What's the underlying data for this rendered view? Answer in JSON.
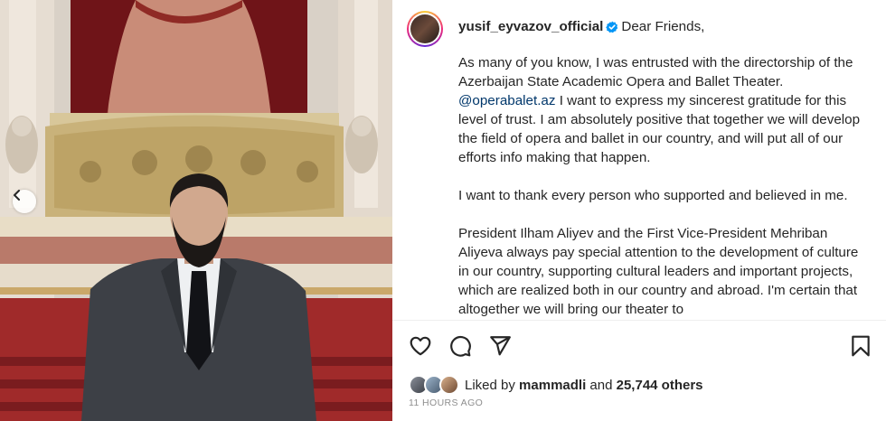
{
  "post": {
    "username": "yusif_eyvazov_official",
    "greeting": "Dear Friends,",
    "paragraphs": [
      "As many of you know, I was entrusted with the directorship of the Azerbaijan State Academic Opera and Ballet Theater.",
      "I want to express my sincerest gratitude for this level of trust. I am absolutely positive that together we will develop the field of opera and ballet in our country, and will put all of our efforts info making that happen.",
      "I want to thank every person who supported and believed in me.",
      "President Ilham Aliyev and the First Vice-President Mehriban Aliyeva always pay special attention to the development of culture in our country, supporting cultural leaders and important projects, which are realized both in our country and abroad. I'm certain that altogether we will bring our theater to"
    ],
    "mention": "@operabalet.az"
  },
  "likes": {
    "prefix": "Liked by",
    "user": "mammadli",
    "connector": "and",
    "others": "25,744 others"
  },
  "timestamp": "11 HOURS AGO",
  "icons": {
    "verified": "verified-badge-icon",
    "like": "heart-icon",
    "comment": "comment-icon",
    "share": "paper-plane-icon",
    "save": "bookmark-icon",
    "prev": "chevron-left-icon"
  },
  "colors": {
    "verified": "#0095f6",
    "mention": "#00376b",
    "text": "#262626",
    "muted": "#8e8e8e"
  }
}
